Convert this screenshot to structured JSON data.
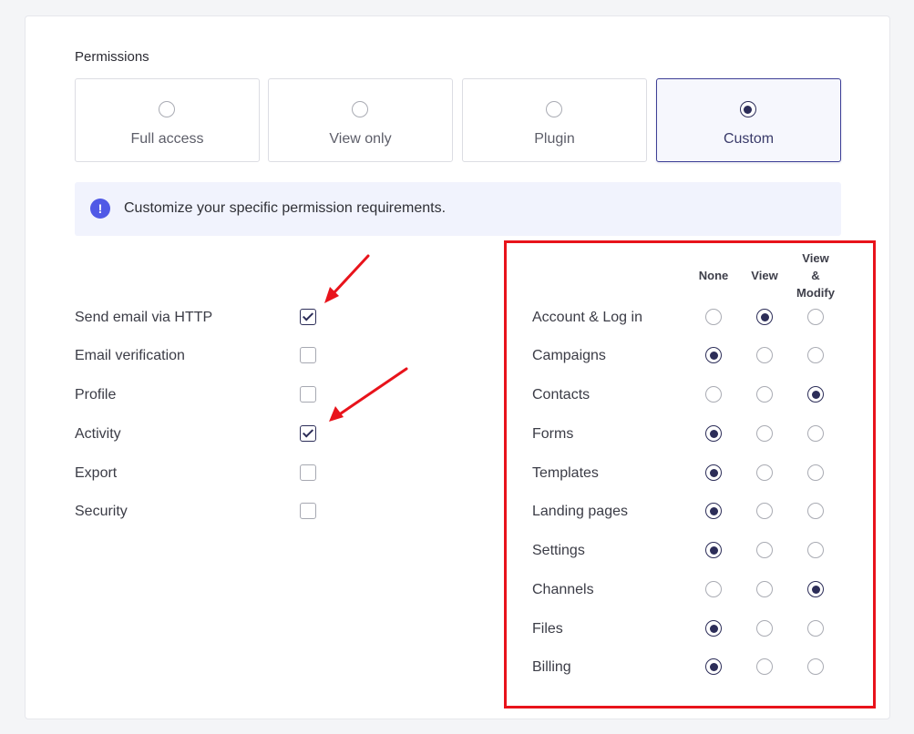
{
  "permissions": {
    "title": "Permissions",
    "options": [
      {
        "label": "Full access",
        "selected": false
      },
      {
        "label": "View only",
        "selected": false
      },
      {
        "label": "Plugin",
        "selected": false
      },
      {
        "label": "Custom",
        "selected": true
      }
    ]
  },
  "info": {
    "icon": "exclamation-icon",
    "text": "Customize your specific permission requirements."
  },
  "checks": [
    {
      "label": "Send email via HTTP",
      "checked": true
    },
    {
      "label": "Email verification",
      "checked": false
    },
    {
      "label": "Profile",
      "checked": false
    },
    {
      "label": "Activity",
      "checked": true
    },
    {
      "label": "Export",
      "checked": false
    },
    {
      "label": "Security",
      "checked": false
    }
  ],
  "matrix": {
    "columns": [
      "None",
      "View",
      "View\n&\nModify"
    ],
    "rows": [
      {
        "label": "Account & Log in",
        "value": 1
      },
      {
        "label": "Campaigns",
        "value": 0
      },
      {
        "label": "Contacts",
        "value": 2
      },
      {
        "label": "Forms",
        "value": 0
      },
      {
        "label": "Templates",
        "value": 0
      },
      {
        "label": "Landing pages",
        "value": 0
      },
      {
        "label": "Settings",
        "value": 0
      },
      {
        "label": "Channels",
        "value": 2
      },
      {
        "label": "Files",
        "value": 0
      },
      {
        "label": "Billing",
        "value": 0
      }
    ]
  },
  "colors": {
    "accent": "#2c2d58",
    "info_icon": "#5059e6",
    "annotation": "#e8131b"
  }
}
